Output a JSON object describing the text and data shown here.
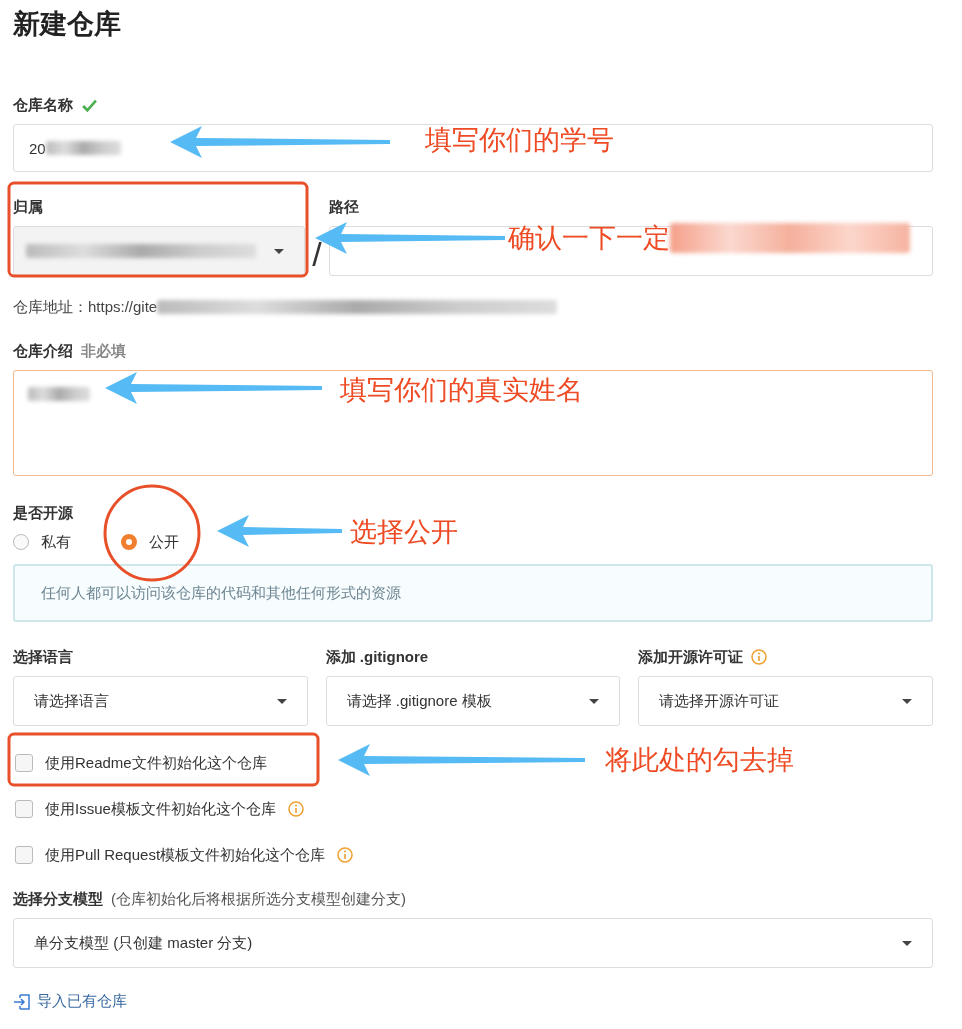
{
  "title": "新建仓库",
  "name": {
    "label": "仓库名称",
    "valid": true,
    "value": "20"
  },
  "owner": {
    "label": "归属"
  },
  "separator": "/",
  "path": {
    "label": "路径"
  },
  "address": {
    "label": "仓库地址：",
    "value": "https://gite"
  },
  "description": {
    "label": "仓库介绍",
    "hint": "非必填"
  },
  "visibility": {
    "label": "是否开源",
    "options": [
      {
        "label": "私有",
        "selected": false
      },
      {
        "label": "公开",
        "selected": true
      }
    ],
    "notice": "任何人都可以访问该仓库的代码和其他任何形式的资源"
  },
  "selects": [
    {
      "label": "选择语言",
      "info": false,
      "value": "请选择语言"
    },
    {
      "label": "添加 .gitignore",
      "info": false,
      "value": "请选择 .gitignore 模板"
    },
    {
      "label": "添加开源许可证",
      "info": true,
      "value": "请选择开源许可证"
    }
  ],
  "checkboxes": [
    {
      "label": "使用Readme文件初始化这个仓库",
      "checked": false,
      "info": false
    },
    {
      "label": "使用Issue模板文件初始化这个仓库",
      "checked": false,
      "info": true
    },
    {
      "label": "使用Pull Request模板文件初始化这个仓库",
      "checked": false,
      "info": true
    }
  ],
  "branch": {
    "label": "选择分支模型",
    "hint": "(仓库初始化后将根据所选分支模型创建分支)",
    "value": "单分支模型 (只创建 master 分支)"
  },
  "import_link": "导入已有仓库",
  "annotations": [
    "填写你们的学号",
    "确认一下一定",
    "填写你们的真实姓名",
    "选择公开",
    "将此处的勾去掉"
  ]
}
